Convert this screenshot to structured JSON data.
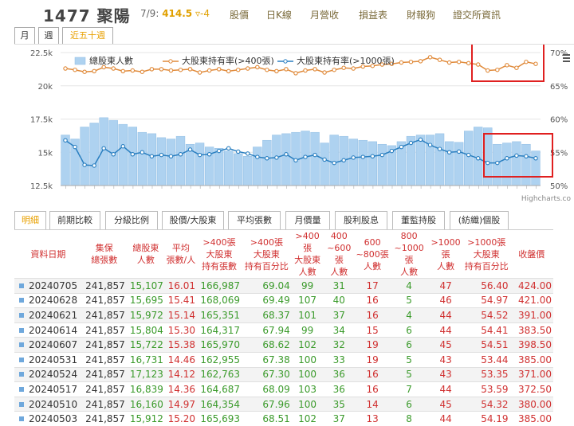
{
  "header": {
    "stock_code": "1477",
    "stock_name": "聚陽",
    "date": "7/9:",
    "price": "414.5",
    "change": "▿-4",
    "nav": [
      "股價",
      "日K線",
      "月營收",
      "損益表",
      "財報狗",
      "證交所資訊"
    ]
  },
  "period_tabs": [
    "月",
    "週",
    "近五十週"
  ],
  "colors": {
    "bar": "#aed2f0",
    "big_holder_line": "#e08a3a",
    "thousand_line": "#2a7fc0",
    "highlight_box": "#e02020",
    "red_text": "#d03030",
    "green_text": "#3a9a2a"
  },
  "chart_data": {
    "type": "bar",
    "legend": [
      "總股東人數",
      "大股東持有率(>400張)",
      "大股東持有率(>1000張)"
    ],
    "y_left_ticks": [
      "22.5k",
      "20k",
      "17.5k",
      "15k",
      "12.5k"
    ],
    "y_right_ticks": [
      "70%",
      "65%",
      "60%",
      "55%",
      "50%"
    ],
    "ylim_left": [
      12500,
      22500
    ],
    "ylim_right": [
      50,
      70
    ],
    "credit": "Highcharts.co",
    "series": [
      {
        "name": "總股東人數",
        "values": [
          16300,
          16000,
          16900,
          17200,
          17600,
          17400,
          17100,
          16900,
          16500,
          16400,
          16100,
          16000,
          16200,
          15600,
          15700,
          15400,
          15300,
          15100,
          14900,
          14700,
          15400,
          15900,
          16300,
          16400,
          16500,
          16600,
          16500,
          15700,
          16300,
          16200,
          16000,
          15900,
          15800,
          15600,
          15500,
          15800,
          16200,
          16300,
          16300,
          16400,
          15800,
          15750,
          16600,
          16900,
          16840,
          15600,
          15700,
          15800,
          15600,
          15100
        ]
      },
      {
        "name": "大股東持有率(>400張)",
        "values": [
          67.6,
          67.4,
          67.1,
          67.2,
          67.8,
          67.6,
          67.2,
          67.3,
          67.1,
          67.5,
          67.5,
          67.3,
          67.4,
          67.5,
          67.0,
          67.3,
          67.5,
          67.2,
          67.4,
          67.6,
          67.8,
          67.4,
          67.2,
          67.5,
          66.9,
          67.3,
          67.5,
          67.0,
          67.4,
          67.7,
          67.6,
          67.9,
          68.0,
          68.2,
          68.3,
          68.5,
          68.6,
          68.7,
          69.3,
          68.9,
          68.5,
          68.6,
          68.4,
          68.2,
          67.3,
          67.4,
          68.1,
          67.7,
          68.6,
          68.3
        ]
      },
      {
        "name": "大股東持有率(>1000張)",
        "values": [
          56.8,
          55.8,
          53.1,
          53.0,
          55.6,
          54.7,
          55.9,
          54.7,
          55.0,
          54.4,
          54.6,
          54.4,
          54.7,
          55.4,
          54.6,
          54.7,
          55.2,
          55.6,
          55.1,
          54.8,
          54.3,
          54.1,
          54.2,
          54.7,
          53.8,
          54.3,
          54.6,
          53.9,
          53.4,
          53.8,
          54.2,
          54.3,
          54.4,
          54.6,
          55.2,
          55.8,
          56.4,
          56.9,
          56.1,
          55.5,
          55.0,
          55.1,
          54.6,
          54.1,
          53.4,
          53.4,
          54.1,
          54.5,
          54.4,
          54.1
        ]
      }
    ]
  },
  "data_tabs": [
    "明細",
    "前期比較",
    "分級比例",
    "股價/大股東",
    "平均張數",
    "月價量",
    "股利股息",
    "董監持股",
    "(紡織)個股"
  ],
  "table": {
    "headers": [
      "資料日期",
      "集保\n總張數",
      "總股東\n人數",
      "平均\n張數/人",
      ">400張\n大股東\n持有張數",
      ">400張\n大股東\n持有百分比",
      ">400張\n大股東\n人數",
      "400\n~600張\n人數",
      "600\n~800張\n人數",
      "800\n~1000張\n人數",
      ">1000張\n人數",
      ">1000張\n大股東\n持有百分比",
      "收盤價"
    ],
    "rows": [
      [
        "20240705",
        "241,857",
        "15,107",
        "16.01",
        "166,987",
        "69.04",
        "99",
        "31",
        "17",
        "4",
        "47",
        "56.40",
        "424.00"
      ],
      [
        "20240628",
        "241,857",
        "15,695",
        "15.41",
        "168,069",
        "69.49",
        "107",
        "40",
        "16",
        "5",
        "46",
        "54.97",
        "421.00"
      ],
      [
        "20240621",
        "241,857",
        "15,972",
        "15.14",
        "165,351",
        "68.37",
        "101",
        "37",
        "16",
        "4",
        "44",
        "54.52",
        "391.00"
      ],
      [
        "20240614",
        "241,857",
        "15,804",
        "15.30",
        "164,317",
        "67.94",
        "99",
        "34",
        "15",
        "6",
        "44",
        "54.41",
        "383.50"
      ],
      [
        "20240607",
        "241,857",
        "15,722",
        "15.38",
        "165,970",
        "68.62",
        "102",
        "32",
        "19",
        "6",
        "45",
        "54.51",
        "398.50"
      ],
      [
        "20240531",
        "241,857",
        "16,731",
        "14.46",
        "162,955",
        "67.38",
        "100",
        "33",
        "19",
        "5",
        "43",
        "53.44",
        "385.00"
      ],
      [
        "20240524",
        "241,857",
        "17,123",
        "14.12",
        "162,763",
        "67.30",
        "100",
        "36",
        "16",
        "5",
        "43",
        "53.35",
        "371.00"
      ],
      [
        "20240517",
        "241,857",
        "16,839",
        "14.36",
        "164,687",
        "68.09",
        "103",
        "36",
        "16",
        "7",
        "44",
        "53.59",
        "372.50"
      ],
      [
        "20240510",
        "241,857",
        "16,160",
        "14.97",
        "164,354",
        "67.96",
        "100",
        "35",
        "14",
        "6",
        "45",
        "54.32",
        "380.00"
      ],
      [
        "20240503",
        "241,857",
        "15,912",
        "15.20",
        "165,693",
        "68.51",
        "102",
        "37",
        "13",
        "8",
        "44",
        "54.19",
        "385.00"
      ]
    ]
  }
}
